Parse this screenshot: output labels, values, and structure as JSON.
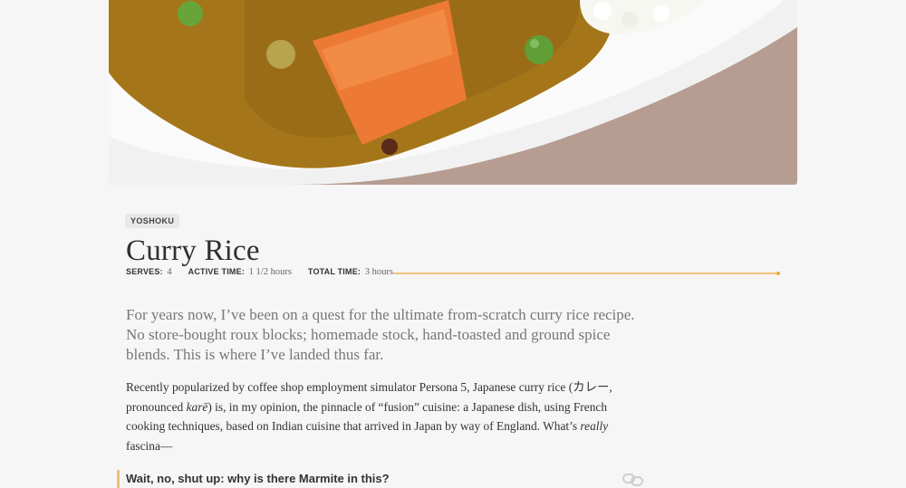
{
  "hero": {
    "image_description": "",
    "colors": {
      "background": "#b59a90",
      "plate": "#f2f2f2",
      "curry": "#a0731e",
      "carrot": "#ed7c35",
      "pea": "#6cae3d",
      "rice": "#f7f7f3"
    }
  },
  "recipe": {
    "category_tag": "YOSHOKU",
    "title": "Curry Rice",
    "meta": {
      "serves_label": "SERVES:",
      "serves_value": "4",
      "active_label": "ACTIVE TIME:",
      "active_value": "1 1/2 hours",
      "total_label": "TOTAL TIME:",
      "total_value": "3 hours"
    },
    "lede": "For years now, I’ve been on a quest for the ultimate from-scratch curry rice recipe. No store-bought roux blocks; homemade stock, hand-toasted and ground spice blends. This is where I’ve landed thus far.",
    "body": {
      "part1": "Recently popularized by coffee shop employment simulator Persona 5, Japanese curry rice (カレー, pronounced ",
      "part2_italic": "karē",
      "part3": ") is, in my opinion, the pinnacle of “fusion” cuisine: a Japanese dish, using French cooking techniques, based on Indian cuisine that arrived in Japan by way of England. What’s ",
      "part4_italic": "really",
      "part5": " fascina—"
    },
    "aside": {
      "title": "Wait, no, shut up: why is there Marmite in this?",
      "icon": "link-icon"
    }
  },
  "colors": {
    "accent": "#f1c27a",
    "page_background": "#f6f6f6"
  }
}
